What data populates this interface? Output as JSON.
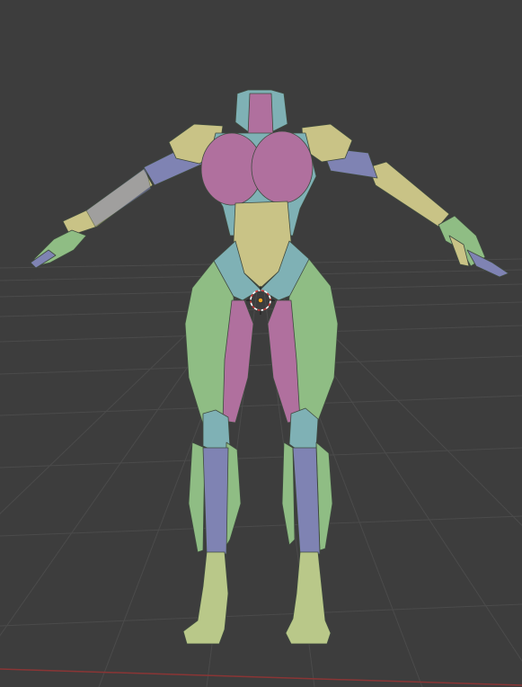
{
  "viewport": {
    "background_color": "#3d3d3d",
    "grid_color": "#4a4a4a",
    "x_axis_color": "#9a3a3a"
  },
  "model": {
    "palette": {
      "green": "#8fbd84",
      "green_dark": "#6f9c69",
      "pink": "#b0709e",
      "pink_dark": "#8e5681",
      "yellow": "#c9c386",
      "yellow_dark": "#a7a16a",
      "teal": "#7fb1b5",
      "teal_dark": "#5f9196",
      "purple": "#7f83b3",
      "purple_dark": "#62669a",
      "feet": "#b9c889"
    }
  },
  "origin_cursor": {
    "ring_color": "#ffffff",
    "dash_color": "#d13b3b",
    "center_color": "#f5a623"
  }
}
